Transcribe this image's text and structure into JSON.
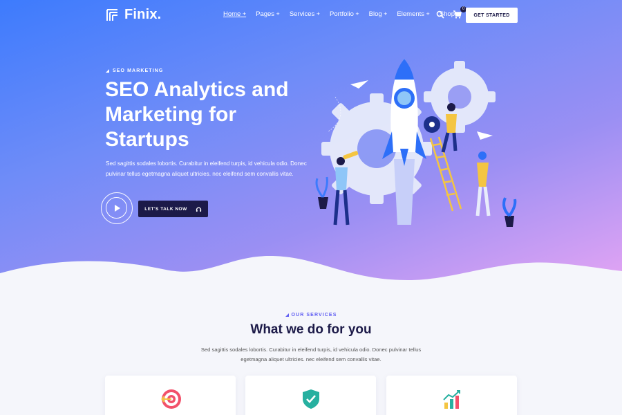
{
  "header": {
    "logo_text": "Finix.",
    "nav": [
      {
        "label": "Home"
      },
      {
        "label": "Pages"
      },
      {
        "label": "Services"
      },
      {
        "label": "Portfolio"
      },
      {
        "label": "Blog"
      },
      {
        "label": "Elements"
      },
      {
        "label": "Shop"
      }
    ],
    "cart_count": "0",
    "cta_label": "GET STARTED"
  },
  "hero": {
    "eyebrow": "SEO MARKETING",
    "title": "SEO Analytics and Marketing for Startups",
    "text": "Sed sagittis sodales lobortis. Curabitur in eleifend turpis, id vehicula odio. Donec pulvinar tellus egetmagna aliquet ultricies. nec eleifend sem convallis vitae.",
    "cta_label": "LET'S TALK NOW"
  },
  "services": {
    "eyebrow": "OUR SERVICES",
    "title": "What we do for you",
    "text": "Sed sagittis sodales lobortis. Curabitur in eleifend turpis, id vehicula odio. Donec pulvinar tellus egetmagna aliquet ultricies. nec eleifend sem convallis vitae.",
    "cards": [
      {
        "icon": "target-icon"
      },
      {
        "icon": "shield-check-icon"
      },
      {
        "icon": "growth-chart-icon"
      }
    ]
  },
  "colors": {
    "gradient_start": "#3d7bfd",
    "gradient_end": "#e9a6f3",
    "dark": "#1c1a48",
    "accent": "#5e5cf2"
  }
}
